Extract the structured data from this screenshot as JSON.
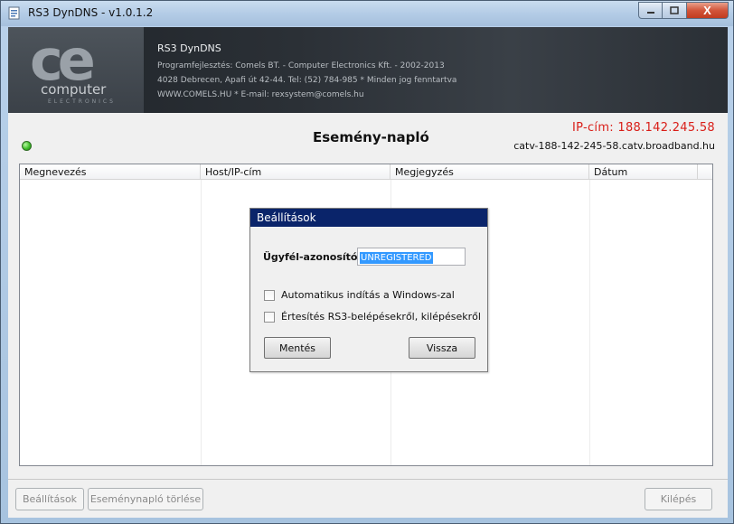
{
  "window": {
    "title": "RS3 DynDNS - v1.0.1.2",
    "icon": "app-icon",
    "close_glyph": "X"
  },
  "banner": {
    "logo_main": "ce",
    "logo_computer": "computer",
    "logo_electronics": "ELECTRONICS",
    "app_name": "RS3 DynDNS",
    "lines": [
      "Programfejlesztés: Comels BT. - Computer Electronics Kft. - 2002-2013",
      "4028 Debrecen, Apafi út 42-44. Tel: (52) 784-985 * Minden jog fenntartva",
      "WWW.COMELS.HU * E-mail: rexsystem@comels.hu"
    ]
  },
  "status": {
    "ip": "IP-cím: 188.142.245.58",
    "host": "catv-188-142-245-58.catv.broadband.hu",
    "indicator_color": "#3fbf2a"
  },
  "main": {
    "title": "Esemény-napló",
    "columns": [
      "Megnevezés",
      "Host/IP-cím",
      "Megjegyzés",
      "Dátum"
    ]
  },
  "dialog": {
    "title": "Beállítások",
    "client_id_label": "Ügyfél-azonosító:",
    "client_id_value": "UNREGISTERED",
    "checkbox_autostart": "Automatikus indítás a Windows-zal",
    "checkbox_notify": "Értesítés RS3-belépésekről, kilépésekről",
    "save_label": "Mentés",
    "back_label": "Vissza"
  },
  "footer": {
    "settings_label": "Beállítások",
    "clear_log_label": "Eseménynapló törlése",
    "exit_label": "Kilépés"
  }
}
